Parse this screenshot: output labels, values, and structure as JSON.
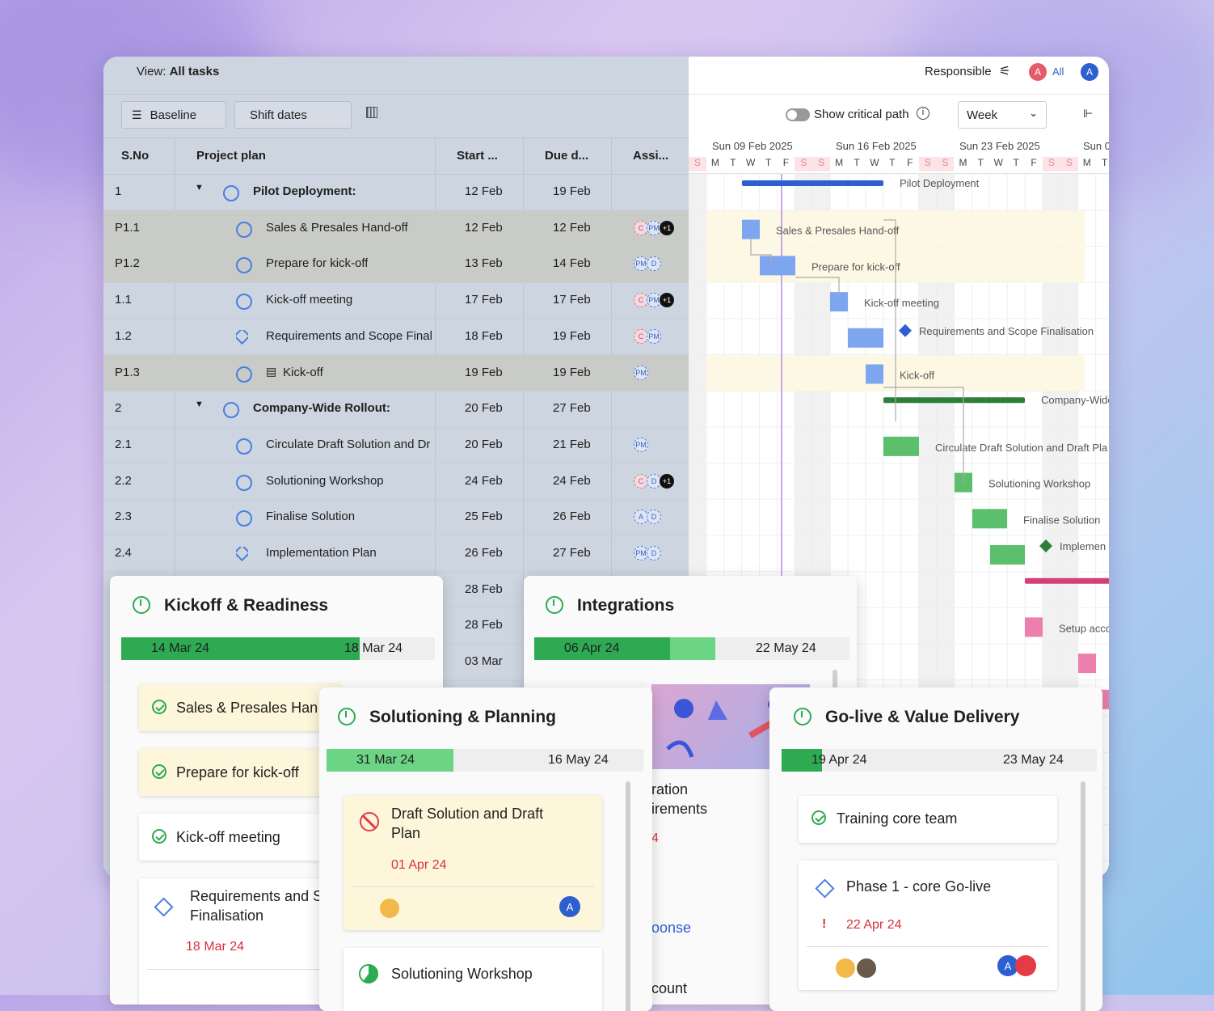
{
  "view": {
    "prefix": "View:",
    "name": "All tasks"
  },
  "toolbar": {
    "baseline": "Baseline",
    "shift_dates": "Shift dates"
  },
  "columns": {
    "sno": "S.No",
    "plan": "Project plan",
    "start": "Start ...",
    "due": "Due d...",
    "assignee": "Assi..."
  },
  "rows": [
    {
      "sno": "1",
      "name": "Pilot Deployment:",
      "start": "12 Feb",
      "due": "19 Feb"
    },
    {
      "sno": "P1.1",
      "name": "Sales & Presales Hand-off",
      "start": "12 Feb",
      "due": "12 Feb",
      "av": [
        "C",
        "PM",
        "+1"
      ]
    },
    {
      "sno": "P1.2",
      "name": "Prepare for kick-off",
      "start": "13 Feb",
      "due": "14 Feb",
      "av": [
        "PM",
        "D"
      ]
    },
    {
      "sno": "1.1",
      "name": "Kick-off meeting",
      "start": "17 Feb",
      "due": "17 Feb",
      "av": [
        "C",
        "PM",
        "+1"
      ]
    },
    {
      "sno": "1.2",
      "name": "Requirements and Scope Final",
      "start": "18 Feb",
      "due": "19 Feb",
      "av": [
        "C",
        "PM"
      ]
    },
    {
      "sno": "P1.3",
      "name": "Kick-off",
      "start": "19 Feb",
      "due": "19 Feb",
      "av": [
        "PM"
      ]
    },
    {
      "sno": "2",
      "name": "Company-Wide Rollout:",
      "start": "20 Feb",
      "due": "27 Feb"
    },
    {
      "sno": "2.1",
      "name": "Circulate Draft Solution and Dr",
      "start": "20 Feb",
      "due": "21 Feb",
      "av": [
        "PM"
      ]
    },
    {
      "sno": "2.2",
      "name": "Solutioning Workshop",
      "start": "24 Feb",
      "due": "24 Feb",
      "av": [
        "C",
        "D",
        "+1"
      ]
    },
    {
      "sno": "2.3",
      "name": "Finalise Solution",
      "start": "25 Feb",
      "due": "26 Feb",
      "av": [
        "A",
        "D"
      ]
    },
    {
      "sno": "2.4",
      "name": "Implementation Plan",
      "start": "26 Feb",
      "due": "27 Feb",
      "av": [
        "PM",
        "D"
      ]
    },
    {
      "sno": "",
      "name": "",
      "start": "28 Feb",
      "due": ""
    },
    {
      "sno": "",
      "name": "",
      "start": "28 Feb",
      "due": ""
    },
    {
      "sno": "",
      "name": "",
      "start": "03 Mar",
      "due": ""
    }
  ],
  "top_right": {
    "responsible": "Responsible",
    "all": "All",
    "avatar_a": "A",
    "avatar_a2": "A"
  },
  "controls": {
    "critical_path": "Show critical path",
    "scale": "Week"
  },
  "weeks": [
    "Sun 09 Feb 2025",
    "Sun 16 Feb 2025",
    "Sun 23 Feb 2025",
    "Sun 0"
  ],
  "days": [
    "S",
    "M",
    "T",
    "W",
    "T",
    "F",
    "S",
    "S",
    "M",
    "T",
    "W",
    "T",
    "F",
    "S",
    "S",
    "M",
    "T",
    "W",
    "T",
    "F",
    "S",
    "S",
    "M",
    "T"
  ],
  "gantt_labels": {
    "pilot": "Pilot Deployment",
    "sales": "Sales & Presales Hand-off",
    "prepare": "Prepare for kick-off",
    "kickoff_meeting": "Kick-off meeting",
    "requirements": "Requirements and Scope Finalisation",
    "kickoff": "Kick-off",
    "company": "Company-Wide",
    "circulate": "Circulate Draft Solution and Draft Pla",
    "workshop": "Solutioning Workshop",
    "finalise": "Finalise Solution",
    "implementation": "Implemen",
    "setup": "Setup acco"
  },
  "card_kickoff": {
    "title": "Kickoff & Readiness",
    "start": "14 Mar 24",
    "end": "18 Mar 24",
    "tasks": [
      "Sales & Presales Han",
      "Prepare for kick-off",
      "Kick-off meeting"
    ],
    "req_title": "Requirements and S",
    "req_title2": "Finalisation",
    "req_date": "18 Mar 24"
  },
  "card_integrations": {
    "title": "Integrations",
    "start": "06 Apr 24",
    "end": "22 May 24",
    "frag1": "ration",
    "frag2": "irements",
    "frag3": "4",
    "frag4": "oonse",
    "frag5": "count"
  },
  "card_solutioning": {
    "title": "Solutioning & Planning",
    "start": "31 Mar 24",
    "end": "16 May 24",
    "task_title": "Draft Solution and Draft",
    "task_title2": "Plan",
    "task_date": "01 Apr 24",
    "task_avatar": "A",
    "task2": "Solutioning Workshop"
  },
  "card_golive": {
    "title": "Go-live & Value Delivery",
    "start": "19 Apr 24",
    "end": "23 May 24",
    "task1": "Training core team",
    "task2": "Phase 1 - core Go-live",
    "task2_mark": "!",
    "task2_date": "22 Apr 24",
    "avatar": "A"
  }
}
